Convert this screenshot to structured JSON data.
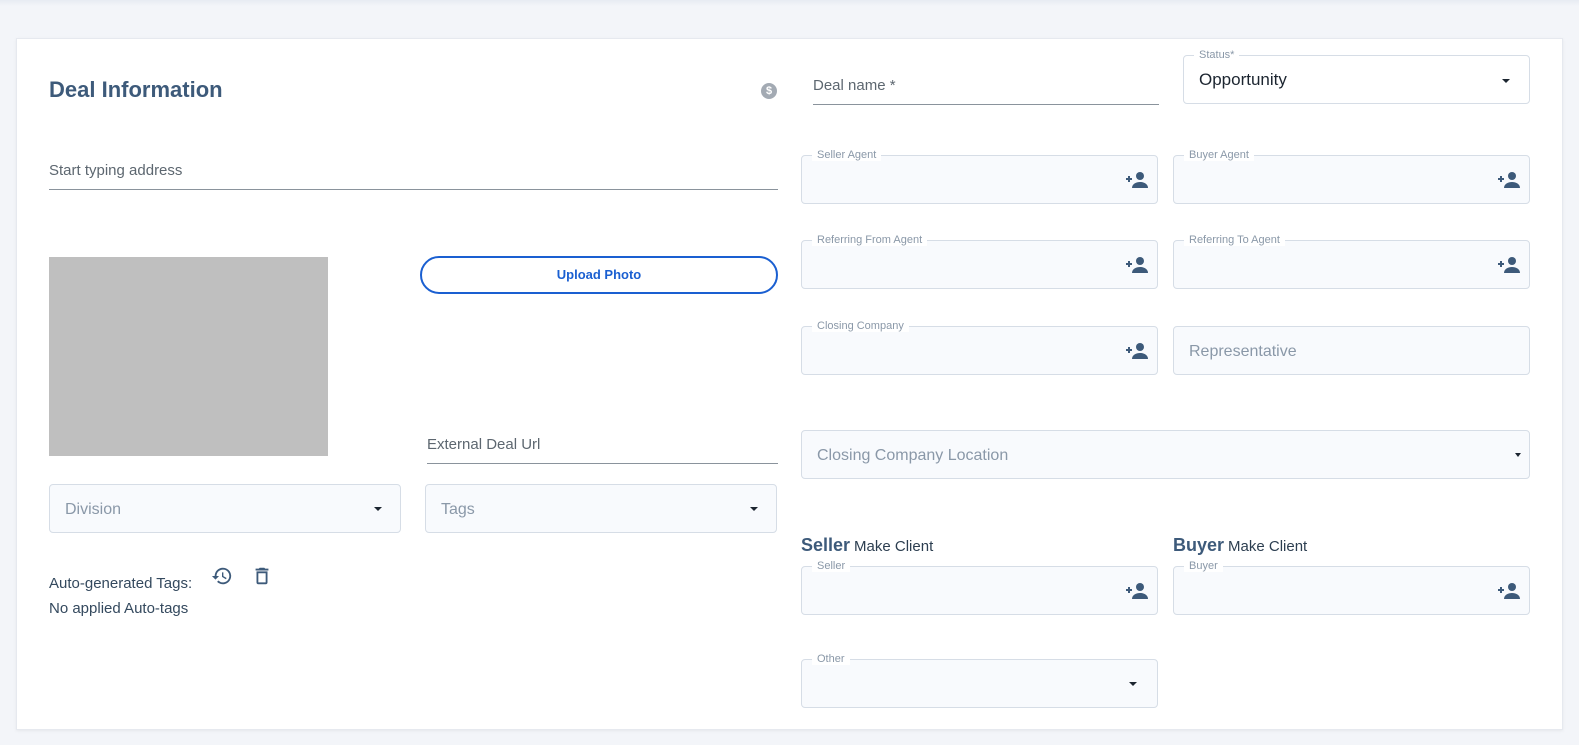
{
  "title": "Deal Information",
  "dollar_icon": "$",
  "address": {
    "placeholder": "Start typing address"
  },
  "upload_photo_label": "Upload Photo",
  "external_url": {
    "placeholder": "External Deal Url"
  },
  "division": {
    "placeholder": "Division"
  },
  "tags": {
    "placeholder": "Tags"
  },
  "auto_tags": {
    "label": "Auto-generated Tags:",
    "empty": "No applied Auto-tags"
  },
  "deal_name": {
    "placeholder": "Deal name *"
  },
  "status": {
    "label": "Status*",
    "value": "Opportunity"
  },
  "seller_agent": {
    "label": "Seller Agent"
  },
  "buyer_agent": {
    "label": "Buyer Agent"
  },
  "referring_from": {
    "label": "Referring From Agent"
  },
  "referring_to": {
    "label": "Referring To Agent"
  },
  "closing_company": {
    "label": "Closing Company"
  },
  "representative": {
    "placeholder": "Representative"
  },
  "closing_location": {
    "placeholder": "Closing Company Location"
  },
  "seller_section": {
    "heading": "Seller",
    "action": "Make Client",
    "field_label": "Seller"
  },
  "buyer_section": {
    "heading": "Buyer",
    "action": "Make Client",
    "field_label": "Buyer"
  },
  "other": {
    "label": "Other"
  },
  "icons": {
    "add_person": "add-person-icon",
    "history": "history-icon",
    "trash": "trash-icon",
    "dropdown": "caret-down-icon"
  },
  "colors": {
    "accent": "#1a5fd1",
    "heading": "#3d5a7a",
    "photo_placeholder": "#bfbfbf"
  }
}
